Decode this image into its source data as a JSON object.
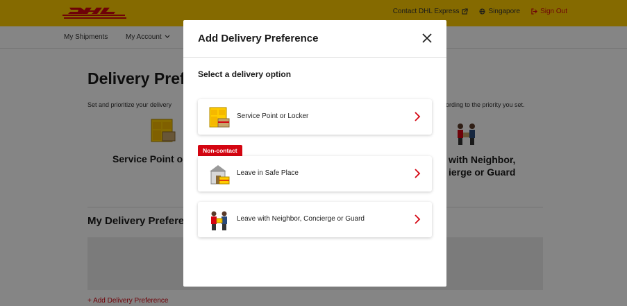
{
  "header": {
    "logo_text": "DHL",
    "contact_link": "Contact DHL Express",
    "region": "Singapore",
    "signout": "Sign Out"
  },
  "nav": {
    "items": [
      {
        "label": "My Shipments"
      },
      {
        "label": "My Account"
      }
    ]
  },
  "page": {
    "title": "Delivery Pref",
    "desc_left": "Set and prioritize your delivery",
    "desc_right": "ording to the priority you set.",
    "option_left": "Service Point or",
    "option_right_line1": "with Neighbor,",
    "option_right_line2": "ierge or Guard",
    "section_title": "My Delivery Prefere",
    "add_link": "+ Add Delivery Preference"
  },
  "modal": {
    "title": "Add Delivery Preference",
    "subtitle": "Select a delivery option",
    "badge": "Non-contact",
    "options": [
      {
        "label": "Service Point or Locker",
        "icon": "locker-icon"
      },
      {
        "label": "Leave in Safe Place",
        "icon": "safe-place-icon"
      },
      {
        "label": "Leave with Neighbor, Concierge or Guard",
        "icon": "neighbor-icon"
      }
    ]
  },
  "colors": {
    "brand_yellow": "#ffcc00",
    "brand_red": "#d40511"
  }
}
